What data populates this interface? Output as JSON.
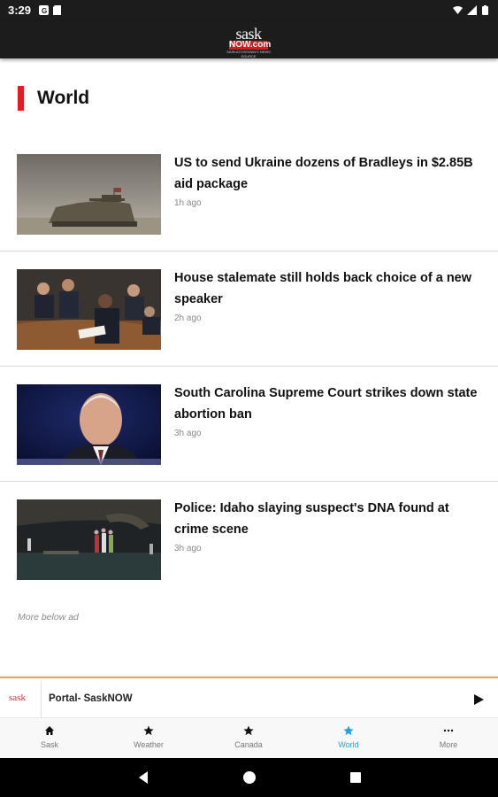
{
  "status_bar": {
    "time": "3:29"
  },
  "app_bar": {
    "logo_top": "sask",
    "logo_mid": "NOW.com",
    "logo_bottom": "SASKATCHEWAN'S NEWS SOURCE"
  },
  "section": {
    "title": "World"
  },
  "articles": [
    {
      "headline": "US to send Ukraine dozens of Bradleys in $2.85B aid package",
      "age": "1h ago"
    },
    {
      "headline": "House stalemate still holds back choice of a new speaker",
      "age": "2h ago"
    },
    {
      "headline": "South Carolina Supreme Court strikes down state abortion ban",
      "age": "3h ago"
    },
    {
      "headline": "Police: Idaho slaying suspect's DNA found at crime scene",
      "age": "3h ago"
    }
  ],
  "more_note": "More below ad",
  "player": {
    "art_text": "sask",
    "title": "Portal- SaskNOW"
  },
  "nav": {
    "items": [
      {
        "label": "Sask",
        "icon": "home-icon"
      },
      {
        "label": "Weather",
        "icon": "star-icon"
      },
      {
        "label": "Canada",
        "icon": "star-icon"
      },
      {
        "label": "World",
        "icon": "star-icon"
      },
      {
        "label": "More",
        "icon": "dots-icon"
      }
    ],
    "active_color": "#1fa0e6"
  },
  "colors": {
    "accent": "#e31b23",
    "app_bar": "#1c1c1c"
  }
}
